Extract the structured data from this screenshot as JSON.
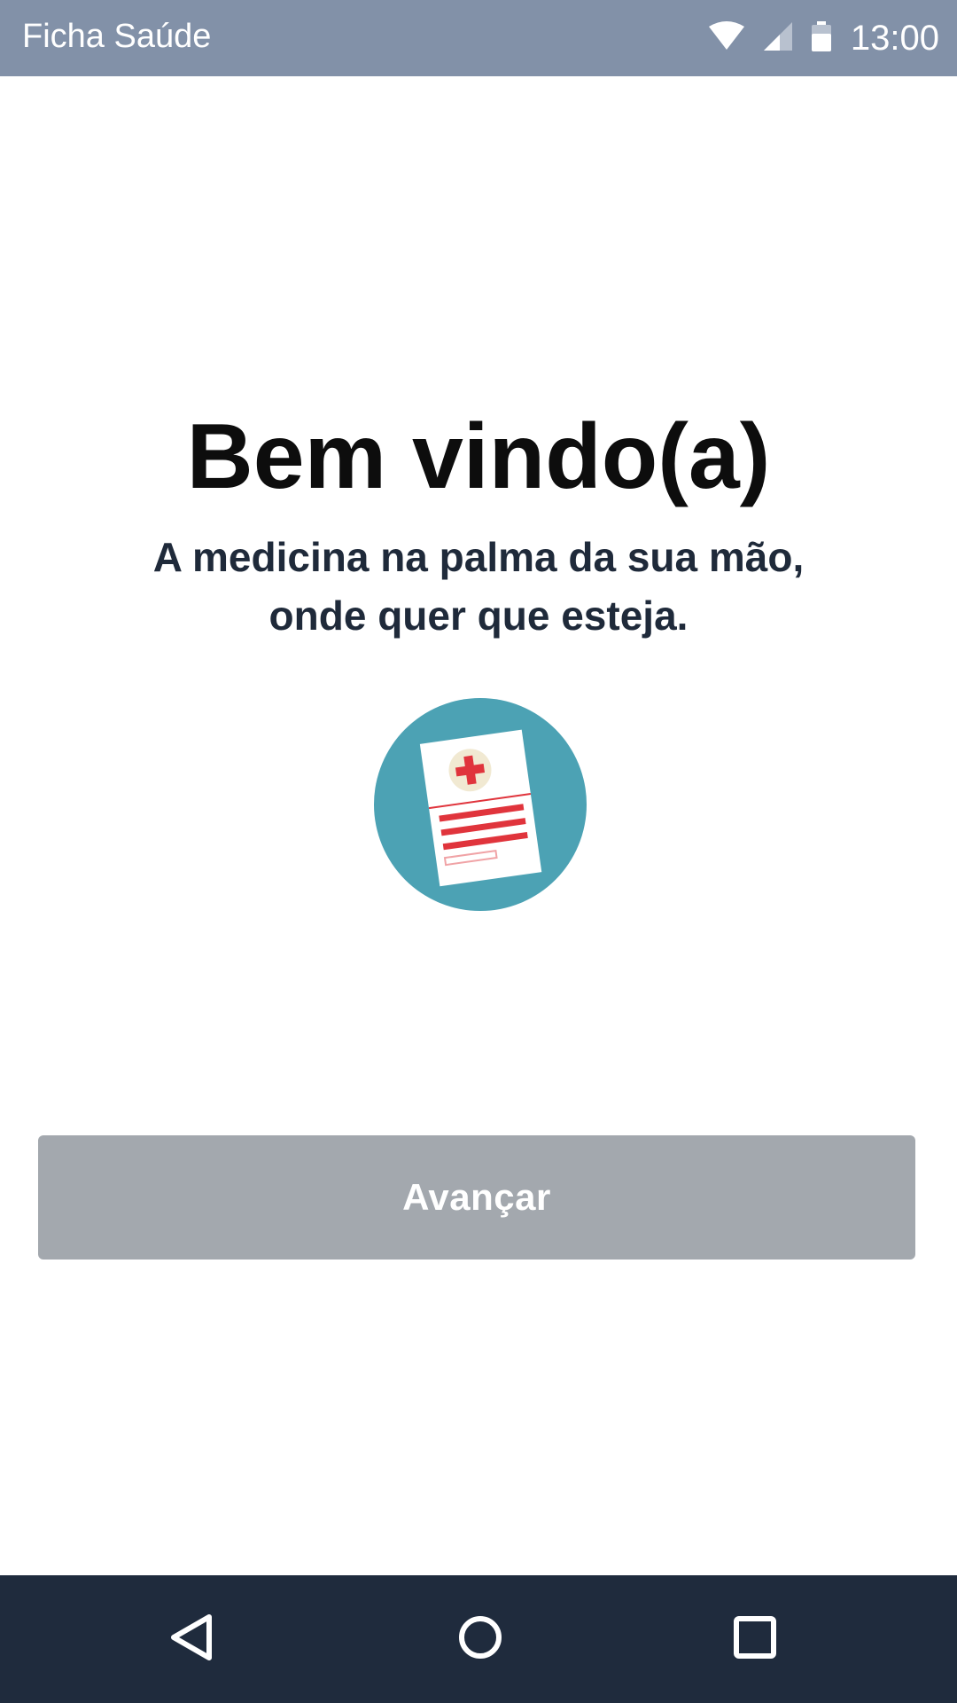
{
  "status_bar": {
    "app_title": "Ficha Saúde",
    "time": "13:00",
    "icons": [
      "wifi-icon",
      "signal-icon",
      "battery-icon"
    ],
    "background_color": "#8291a8"
  },
  "welcome": {
    "title": "Bem vindo(a)",
    "subtitle_line1": "A medicina na palma da sua mão,",
    "subtitle_line2": "onde quer que esteja."
  },
  "illustration": {
    "icon": "medical-record-icon",
    "circle_color": "#4ca2b4",
    "accent_color": "#e0343c"
  },
  "actions": {
    "next_label": "Avançar",
    "next_color": "#a3a8ae"
  },
  "nav_bar": {
    "icons": [
      "back-icon",
      "home-icon",
      "recents-icon"
    ],
    "background_color": "#1f2b3d"
  }
}
